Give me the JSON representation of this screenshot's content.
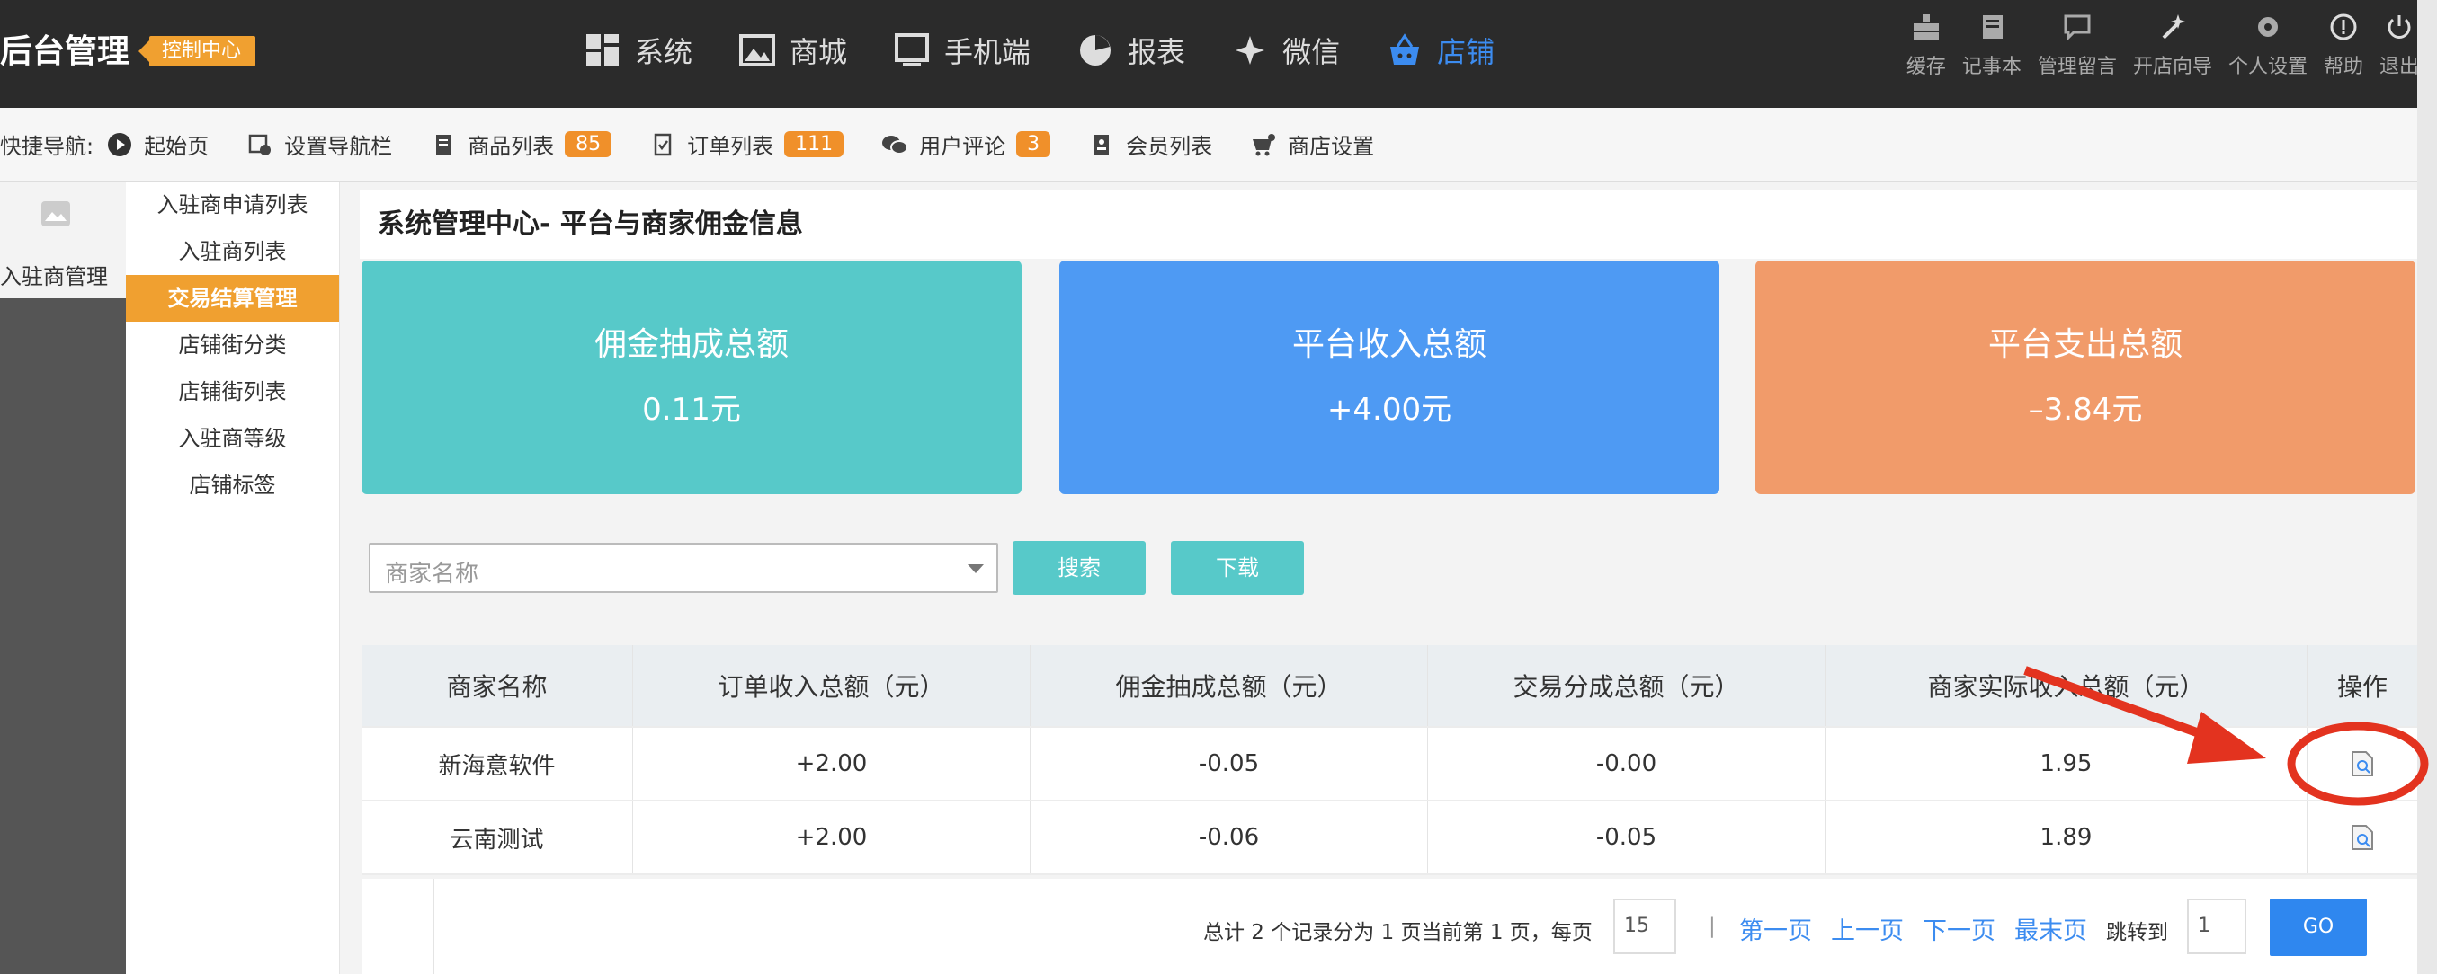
{
  "header": {
    "brand": "后台管理",
    "badge": "控制中心",
    "nav": [
      {
        "label": "系统",
        "icon": "grid-icon"
      },
      {
        "label": "商城",
        "icon": "image-icon"
      },
      {
        "label": "手机端",
        "icon": "monitor-icon"
      },
      {
        "label": "报表",
        "icon": "pie-chart-icon"
      },
      {
        "label": "微信",
        "icon": "wechat-icon"
      },
      {
        "label": "店铺",
        "icon": "shopping-basket-icon",
        "active": true
      }
    ],
    "tools": [
      {
        "label": "缓存",
        "icon": "cache-icon"
      },
      {
        "label": "记事本",
        "icon": "notebook-icon"
      },
      {
        "label": "管理留言",
        "icon": "message-icon"
      },
      {
        "label": "开店向导",
        "icon": "wizard-icon"
      },
      {
        "label": "个人设置",
        "icon": "gear-icon"
      },
      {
        "label": "帮助",
        "icon": "help-icon"
      },
      {
        "label": "退出",
        "icon": "power-icon"
      }
    ]
  },
  "quicknav": {
    "label": "快捷导航:",
    "items": [
      {
        "label": "起始页",
        "icon": "play-icon"
      },
      {
        "label": "设置导航栏",
        "icon": "nav-settings-icon"
      },
      {
        "label": "商品列表",
        "icon": "goods-icon",
        "badge": "85"
      },
      {
        "label": "订单列表",
        "icon": "order-icon",
        "badge": "111"
      },
      {
        "label": "用户评论",
        "icon": "comment-icon",
        "badge": "3"
      },
      {
        "label": "会员列表",
        "icon": "member-icon"
      },
      {
        "label": "商店设置",
        "icon": "shop-settings-icon"
      }
    ]
  },
  "leftbar": {
    "active_label": "入驻商管理"
  },
  "subnav": {
    "items": [
      "入驻商申请列表",
      "入驻商列表",
      "交易结算管理",
      "店铺街分类",
      "店铺街列表",
      "入驻商等级",
      "店铺标签"
    ],
    "active_index": 2
  },
  "page": {
    "title": "系统管理中心- 平台与商家佣金信息",
    "cards": [
      {
        "title": "佣金抽成总额",
        "value": "0.11元",
        "color": "#57c9c9"
      },
      {
        "title": "平台收入总额",
        "value": "+4.00元",
        "color": "#4e9af3"
      },
      {
        "title": "平台支出总额",
        "value": "–3.84元",
        "color": "#f19b6a"
      }
    ],
    "filter": {
      "placeholder": "商家名称"
    },
    "buttons": {
      "search": "搜索",
      "download": "下载"
    }
  },
  "table": {
    "headers": [
      "商家名称",
      "订单收入总额（元）",
      "佣金抽成总额（元）",
      "交易分成总额（元）",
      "商家实际收入总额（元）",
      "操作"
    ],
    "rows": [
      [
        "新海意软件",
        "+2.00",
        "-0.05",
        "-0.00",
        "1.95"
      ],
      [
        "云南测试",
        "+2.00",
        "-0.06",
        "-0.05",
        "1.89"
      ]
    ]
  },
  "pager": {
    "summary": "总计 2 个记录分为 1 页当前第 1 页，每页",
    "per_page": "15",
    "sep": "|",
    "first": "第一页",
    "prev": "上一页",
    "next": "下一页",
    "last": "最末页",
    "jump_label": "跳转到",
    "jump_value": "1",
    "go": "GO"
  },
  "colors": {
    "accent": "#f0a030",
    "link": "#3c8cf0",
    "annotation": "#e3331f"
  }
}
